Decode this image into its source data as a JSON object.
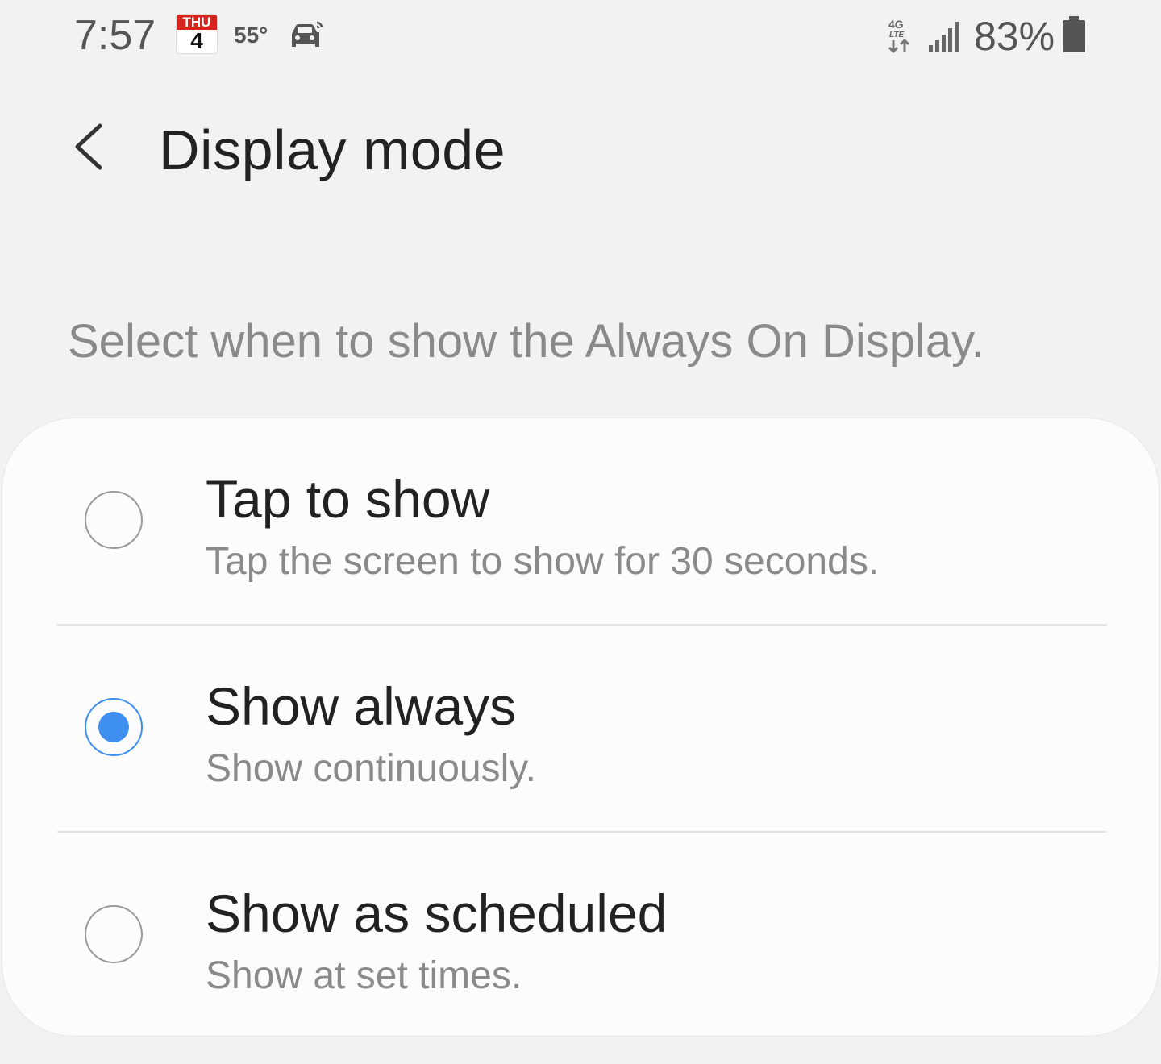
{
  "status_bar": {
    "time": "7:57",
    "calendar_weekday": "THU",
    "calendar_day": "4",
    "temperature": "55°",
    "network_label": "4G LTE",
    "battery_percent": "83%",
    "icons": [
      "calendar-icon",
      "car-icon",
      "lte-icon",
      "signal-icon",
      "battery-icon"
    ]
  },
  "header": {
    "title": "Display mode",
    "back_icon": "chevron-left-icon"
  },
  "description": "Select when to show the Always On Display.",
  "options": [
    {
      "title": "Tap to show",
      "subtitle": "Tap the screen to show for 30 seconds.",
      "selected": false
    },
    {
      "title": "Show always",
      "subtitle": "Show continuously.",
      "selected": true
    },
    {
      "title": "Show as scheduled",
      "subtitle": "Show at set times.",
      "selected": false
    }
  ],
  "colors": {
    "accent": "#3e8ff0",
    "background": "#f2f2f2",
    "card": "#fcfcfc",
    "secondary_text": "#8a8a8a"
  }
}
